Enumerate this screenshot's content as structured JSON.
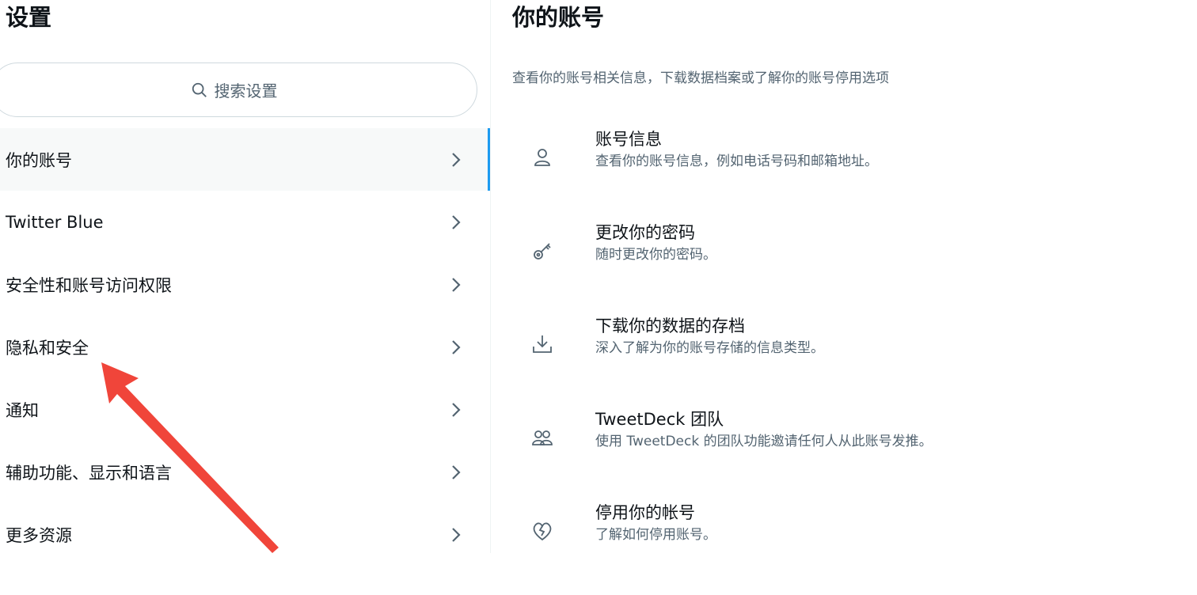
{
  "settings": {
    "title": "设置",
    "search_placeholder": "搜索设置",
    "menu": [
      {
        "label": "你的账号",
        "active": true
      },
      {
        "label": "Twitter Blue"
      },
      {
        "label": "安全性和账号访问权限"
      },
      {
        "label": "隐私和安全"
      },
      {
        "label": "通知"
      },
      {
        "label": "辅助功能、显示和语言"
      },
      {
        "label": "更多资源"
      }
    ]
  },
  "account": {
    "title": "你的账号",
    "subtitle": "查看你的账号相关信息，下载数据档案或了解你的账号停用选项",
    "options": [
      {
        "title": "账号信息",
        "desc": "查看你的账号信息，例如电话号码和邮箱地址。",
        "icon": "person-icon"
      },
      {
        "title": "更改你的密码",
        "desc": "随时更改你的密码。",
        "icon": "key-icon"
      },
      {
        "title": "下载你的数据的存档",
        "desc": "深入了解为你的账号存储的信息类型。",
        "icon": "download-icon"
      },
      {
        "title": "TweetDeck 团队",
        "desc": "使用 TweetDeck 的团队功能邀请任何人从此账号发推。",
        "icon": "people-icon"
      },
      {
        "title": "停用你的帐号",
        "desc": "了解如何停用账号。",
        "icon": "broken-heart-icon"
      }
    ]
  },
  "colors": {
    "accent": "#1d9bf0",
    "annotation_arrow": "#f0453a",
    "secondary_text": "#536471"
  }
}
